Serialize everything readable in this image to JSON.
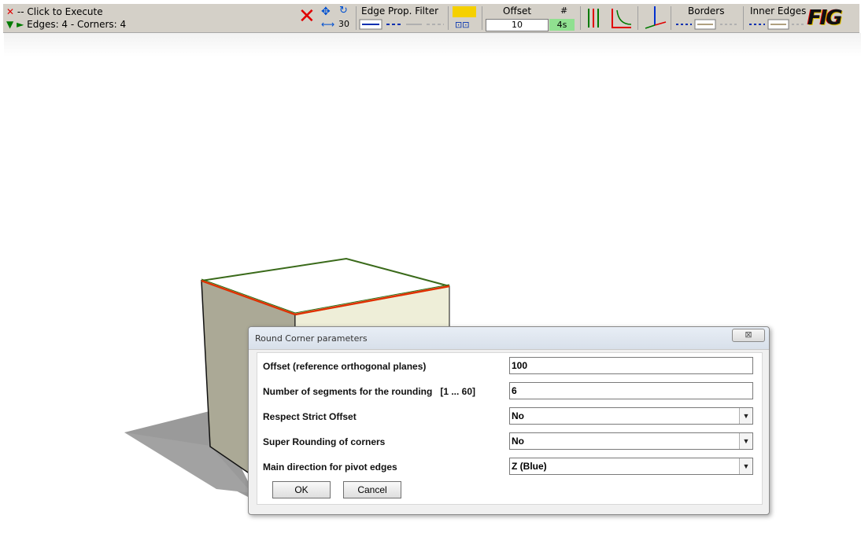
{
  "toolbar": {
    "status_line1": "-- Click to Execute",
    "status_line2": "Edges: 4 - Corners: 4",
    "move_value": "30",
    "edge_prop_filter_label": "Edge Prop. Filter",
    "offset_label": "Offset",
    "offset_value": "10",
    "segments_label": "#",
    "segments_value": "4s",
    "borders_label": "Borders",
    "inner_edges_label": "Inner Edges",
    "logo_text": "FIG",
    "colors": {
      "accent_red": "#e00000",
      "accent_green": "#007a00",
      "swatch_yellow": "#f5d000",
      "cell_green": "#90e090"
    },
    "icons": [
      "delete-icon",
      "move-icon",
      "rotate-icon",
      "edge-filter-icon",
      "vertical-lines-icon",
      "round-corner-icon",
      "axes-icon"
    ]
  },
  "dialog": {
    "title": "Round Corner parameters",
    "close_symbol": "⊠",
    "fields": [
      {
        "label": "Offset (reference orthogonal planes)",
        "value": "100",
        "type": "input"
      },
      {
        "label": "Number of segments for the rounding   [1 ... 60]",
        "value": "6",
        "type": "input"
      },
      {
        "label": "Respect Strict Offset",
        "value": "No",
        "type": "select"
      },
      {
        "label": "Super Rounding of corners",
        "value": "No",
        "type": "select"
      },
      {
        "label": "Main direction for pivot edges",
        "value": "Z (Blue)",
        "type": "select"
      }
    ],
    "ok_label": "OK",
    "cancel_label": "Cancel"
  }
}
